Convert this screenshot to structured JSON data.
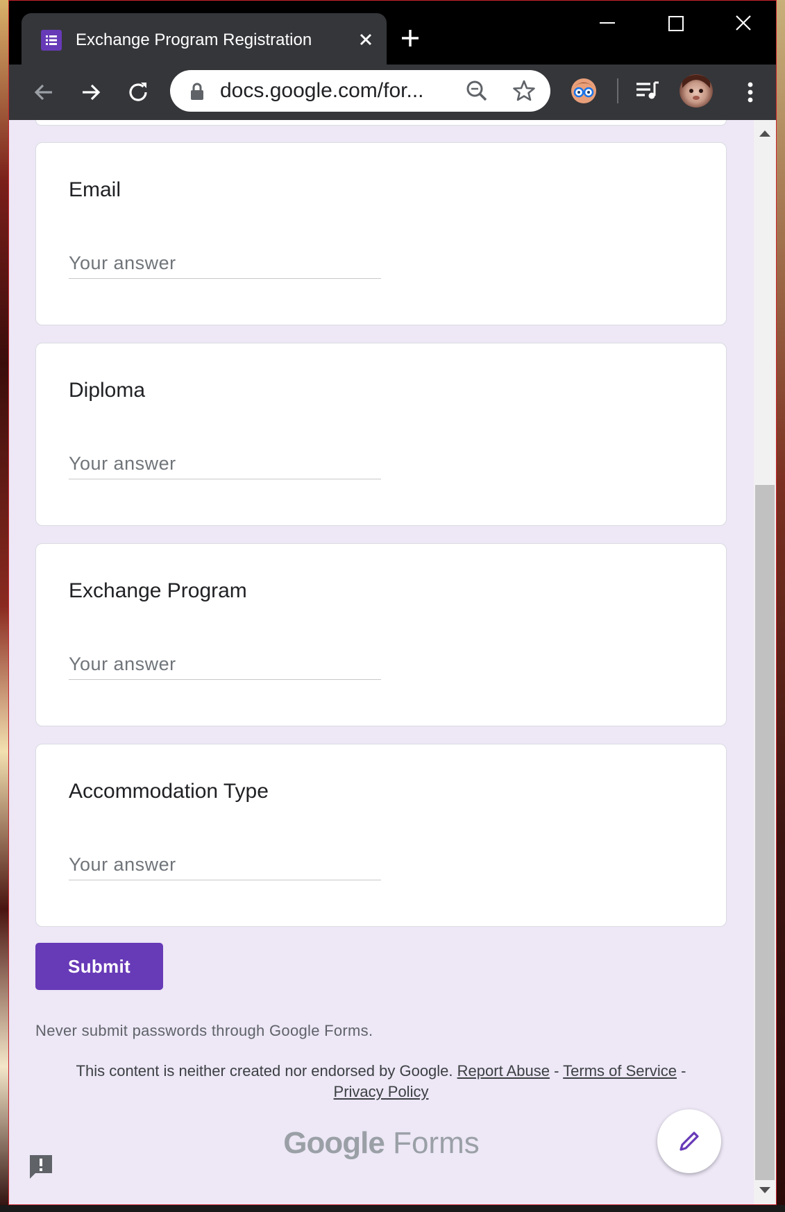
{
  "browser": {
    "tab_title": "Exchange Program Registration",
    "url": "docs.google.com/for...",
    "icons": [
      "forms-icon",
      "close-icon",
      "plus-icon",
      "minimize-icon",
      "maximize-icon",
      "close-window-icon",
      "back-icon",
      "forward-icon",
      "reload-icon",
      "lock-icon",
      "zoom-icon",
      "star-icon",
      "extension-icon",
      "playlist-icon",
      "avatar",
      "menu-icon"
    ]
  },
  "form": {
    "questions": [
      {
        "title": "Email",
        "placeholder": "Your answer",
        "value": ""
      },
      {
        "title": "Diploma",
        "placeholder": "Your answer",
        "value": ""
      },
      {
        "title": "Exchange Program",
        "placeholder": "Your answer",
        "value": ""
      },
      {
        "title": "Accommodation Type",
        "placeholder": "Your answer",
        "value": ""
      }
    ],
    "submit_label": "Submit",
    "warning": "Never submit passwords through Google Forms."
  },
  "footer": {
    "disclaimer": "This content is neither created nor endorsed by Google.",
    "report_abuse": "Report Abuse",
    "terms": "Terms of Service",
    "privacy": "Privacy Policy",
    "sep": "-",
    "logo_google": "Google",
    "logo_forms": "Forms"
  },
  "colors": {
    "accent": "#673ab7",
    "page_bg": "#ede7f6",
    "toolbar": "#35363a"
  }
}
